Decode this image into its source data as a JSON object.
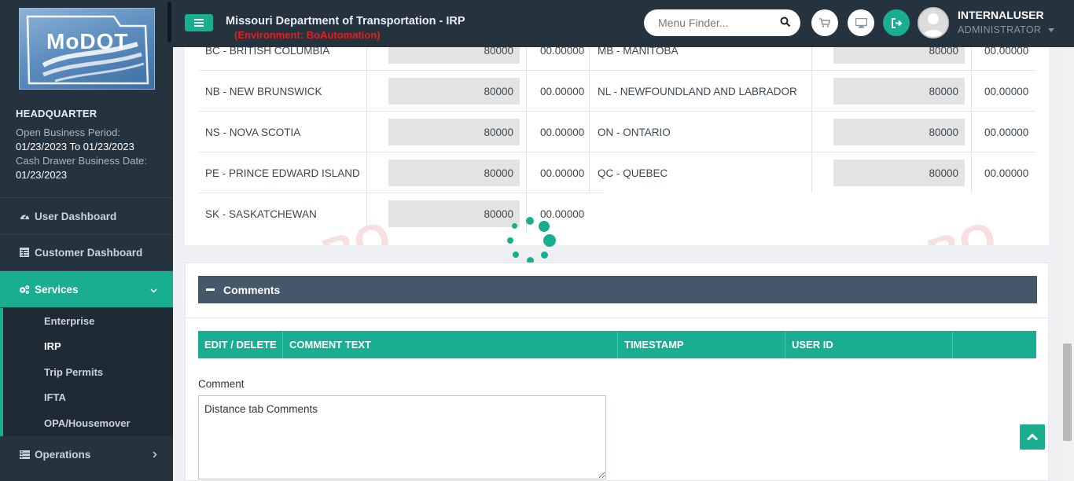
{
  "header": {
    "title": "Missouri Department of Transportation - IRP",
    "environment": "(Environment: BoAutomation)",
    "search_placeholder": "Menu Finder...",
    "user_name": "INTERNALUSER",
    "user_role": "ADMINISTRATOR"
  },
  "sidebar": {
    "logo_text": "MoDOT",
    "office": "HEADQUARTER",
    "open_period_label": "Open Business Period:",
    "open_period_value": "01/23/2023 To 01/23/2023",
    "cash_drawer_label": "Cash Drawer Business Date:",
    "cash_drawer_value": "01/23/2023",
    "nav": [
      {
        "label": "User Dashboard",
        "icon": "dashboard-icon"
      },
      {
        "label": "Customer Dashboard",
        "icon": "grid-icon"
      },
      {
        "label": "Services",
        "icon": "cogs-icon",
        "active": true
      },
      {
        "label": "Operations",
        "icon": "operations-icon"
      }
    ],
    "subnav": [
      {
        "label": "Enterprise"
      },
      {
        "label": "IRP",
        "active": true
      },
      {
        "label": "Trip Permits"
      },
      {
        "label": "IFTA"
      },
      {
        "label": "OPA/Housemover"
      }
    ]
  },
  "jurisdictions": {
    "left": [
      {
        "name": "BC - BRITISH COLUMBIA",
        "miles": "80000",
        "percent": "00.00000"
      },
      {
        "name": "NB - NEW BRUNSWICK",
        "miles": "80000",
        "percent": "00.00000"
      },
      {
        "name": "NS - NOVA SCOTIA",
        "miles": "80000",
        "percent": "00.00000"
      },
      {
        "name": "PE - PRINCE EDWARD ISLAND",
        "miles": "80000",
        "percent": "00.00000"
      },
      {
        "name": "SK - SASKATCHEWAN",
        "miles": "80000",
        "percent": "00.00000"
      }
    ],
    "right": [
      {
        "name": "MB - MANITOBA",
        "miles": "80000",
        "percent": "00.00000"
      },
      {
        "name": "NL - NEWFOUNDLAND AND LABRADOR",
        "miles": "80000",
        "percent": "00.00000"
      },
      {
        "name": "ON - ONTARIO",
        "miles": "80000",
        "percent": "00.00000"
      },
      {
        "name": "QC - QUEBEC",
        "miles": "80000",
        "percent": "00.00000"
      }
    ]
  },
  "comments": {
    "section_title": "Comments",
    "columns": [
      "EDIT / DELETE",
      "COMMENT TEXT",
      "TIMESTAMP",
      "USER ID",
      ""
    ],
    "comment_label": "Comment",
    "comment_value": "Distance tab Comments"
  },
  "colors": {
    "accent": "#1aae91",
    "sidebar": "#25333f",
    "section_header": "#455769",
    "environment": "#e0201e"
  }
}
